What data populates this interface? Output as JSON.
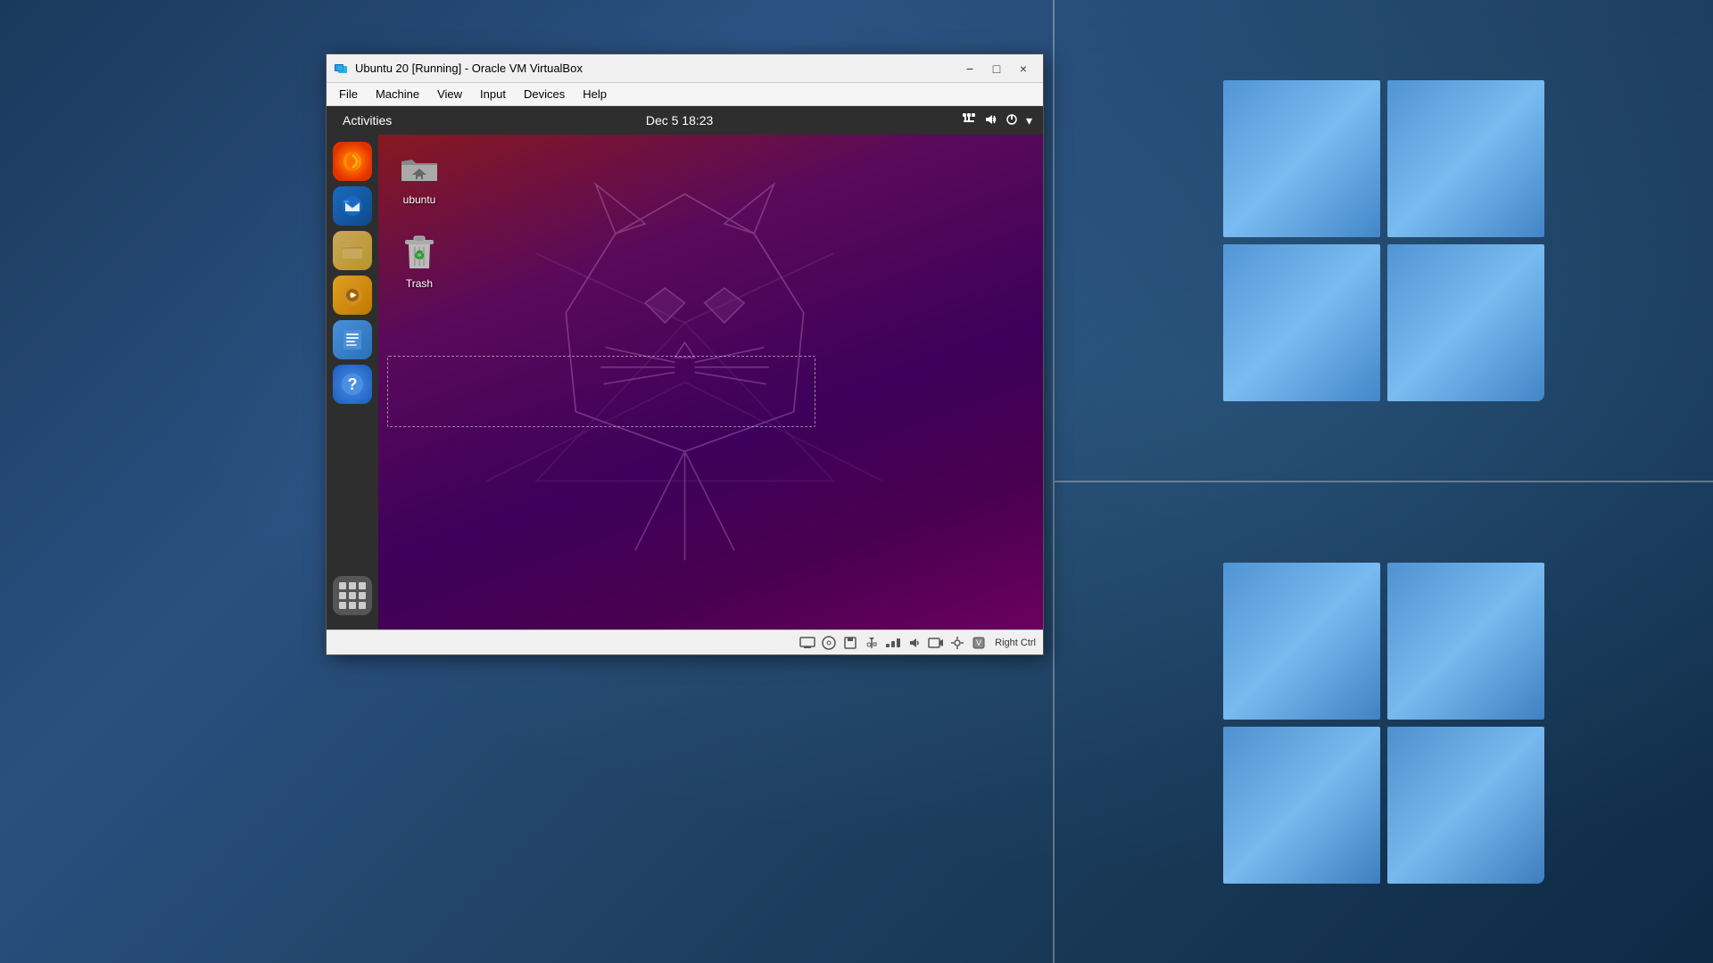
{
  "windows": {
    "bg_description": "Windows 10 desktop background blue gradient"
  },
  "vbox": {
    "title": "Ubuntu 20 [Running] - Oracle VM VirtualBox",
    "titlebar_icon": "virtualbox",
    "minimize_label": "−",
    "maximize_label": "□",
    "close_label": "×",
    "menu": {
      "items": [
        "File",
        "Machine",
        "View",
        "Input",
        "Devices",
        "Help"
      ]
    }
  },
  "ubuntu": {
    "topbar": {
      "activities": "Activities",
      "clock": "Dec 5  18:23",
      "tray_icons": [
        "network",
        "volume",
        "power",
        "dropdown"
      ]
    },
    "dock": {
      "icons": [
        {
          "name": "firefox",
          "label": "Firefox"
        },
        {
          "name": "thunderbird",
          "label": "Thunderbird"
        },
        {
          "name": "files",
          "label": "Files"
        },
        {
          "name": "rhythmbox",
          "label": "Rhythmbox"
        },
        {
          "name": "writer",
          "label": "Writer"
        },
        {
          "name": "help",
          "label": "Help"
        }
      ],
      "apps_button_label": "Show Applications"
    },
    "desktop_icons": [
      {
        "name": "ubuntu-home",
        "label": "ubuntu",
        "type": "home"
      },
      {
        "name": "trash",
        "label": "Trash",
        "type": "trash"
      }
    ]
  },
  "vbox_statusbar": {
    "right_ctrl_label": "Right Ctrl",
    "icons": [
      "screen",
      "cd",
      "floppy",
      "usb",
      "network",
      "audio",
      "capture",
      "host"
    ]
  }
}
